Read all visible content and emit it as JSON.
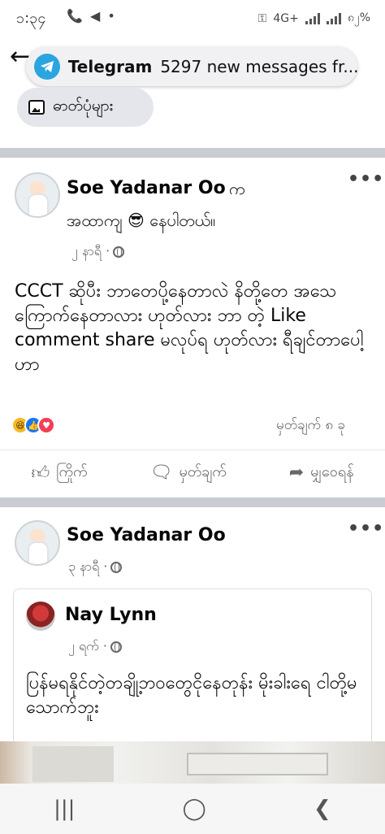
{
  "status_bar": {
    "time": "၁:၃၄",
    "left_icons": "📞 ◀ •",
    "network": "4G+",
    "battery": "၈၂%"
  },
  "notification": {
    "app": "Telegram",
    "text": "5297 new messages fr..."
  },
  "photos_button": {
    "label": "ဓာတ်ပုံများ"
  },
  "post1": {
    "author": "Soe Yadanar Oo",
    "author_suffix": "က",
    "feeling": "အထာကျ 😎 နေပါတယ်။",
    "time": "၂ နာရီ ·",
    "text": "CCCT ဆိုပီး ဘာတေပို့နေတာလဲ နိတို့တေ အသေ ကြောက်နေတာလား ဟုတ်လား ဘာ တဲ့ Like comment  share မလုပ်ရ ဟုတ်လား ရီချင်တာပေါ့ဟာ",
    "comments": "မှတ်ချက် ၈ ခု",
    "actions": {
      "like": "ကြိုက်",
      "comment": "မှတ်ချက်",
      "share": "မျှဝေရန်"
    }
  },
  "post2": {
    "author": "Soe Yadanar Oo",
    "time": "၃ နာရီ ·",
    "shared": {
      "author": "Nay Lynn",
      "time": "၂ ရက် ·",
      "text": "ပြန်မရနိုင်တဲ့တချို့ဘဝတွေငိုနေတုန်း မိုးခါးရေ ငါတို့မသောက်ဘူး"
    }
  },
  "nav": {
    "recent": "|||",
    "home": "◯",
    "back": "❮"
  },
  "colors": {
    "accent": "#1877f2",
    "telegram": "#2aa5e0",
    "divider": "#c9ccd1"
  }
}
